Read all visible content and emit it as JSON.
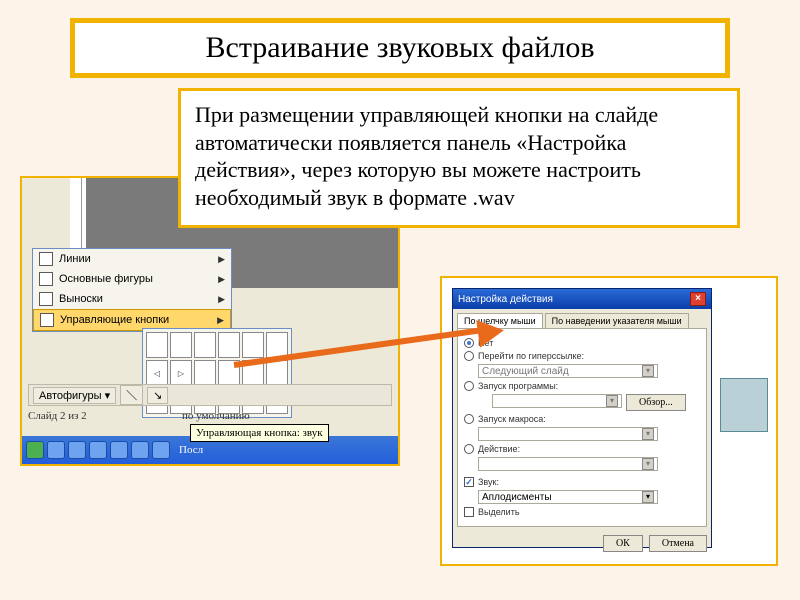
{
  "title": "Встраивание звуковых файлов",
  "body_text": "При размещении управляющей кнопки на слайде автоматически появляется панель «Настройка действия», через которую вы можете настроить необходимый звук в формате .wav",
  "menu": {
    "item_lines": "Линии",
    "item_shapes": "Основные фигуры",
    "item_callouts": "Выноски",
    "item_action_buttons": "Управляющие кнопки"
  },
  "autoshapes_button": "Автофигуры",
  "slide_counter": "Слайд 2 из 2",
  "default_label": "по умолчанию",
  "tooltip_sound_button": "Управляющая кнопка: звук",
  "taskbar_app": "Посл",
  "dialog": {
    "title": "Настройка действия",
    "tab_click": "По щелчку мыши",
    "tab_hover": "По наведении указателя мыши",
    "opt_none": "Нет",
    "opt_hyperlink": "Перейти по гиперссылке:",
    "hyperlink_value": "Следующий слайд",
    "opt_run_program": "Запуск программы:",
    "browse": "Обзор...",
    "opt_run_macro": "Запуск макроса:",
    "opt_action": "Действие:",
    "chk_sound": "Звук:",
    "sound_value": "Аплодисменты",
    "chk_highlight": "Выделить",
    "btn_ok": "ОК",
    "btn_cancel": "Отмена"
  }
}
